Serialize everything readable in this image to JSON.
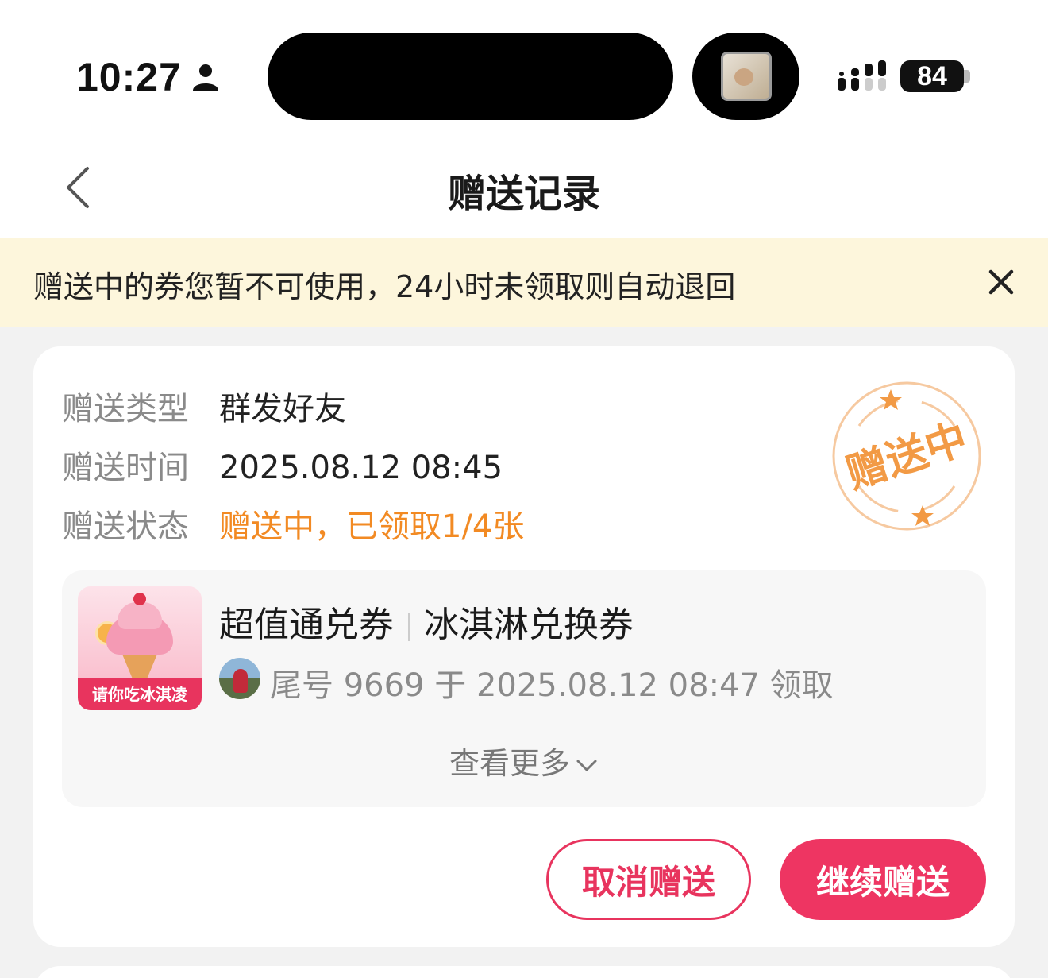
{
  "status_bar": {
    "time": "10:27",
    "battery": "84",
    "icons": [
      "person-icon",
      "signal-icon",
      "battery-icon"
    ]
  },
  "nav": {
    "title": "赠送记录",
    "back_icon": "chevron-left-icon"
  },
  "notice": {
    "text": "赠送中的券您暂不可使用，24小时未领取则自动退回",
    "close_icon": "close-icon"
  },
  "record": {
    "type_label": "赠送类型",
    "type_value": "群发好友",
    "time_label": "赠送时间",
    "time_value": "2025.08.12 08:45",
    "status_label": "赠送状态",
    "status_value": "赠送中，已领取1/4张",
    "stamp_text": "赠送中",
    "status_color": "#f28a23"
  },
  "coupon": {
    "image_label": "请你吃冰淇凌",
    "title_main": "超值通兑券",
    "title_sub": "冰淇淋兑换券",
    "claim_text": "尾号 9669  于 2025.08.12 08:47 领取",
    "more_label": "查看更多"
  },
  "actions": {
    "cancel_label": "取消赠送",
    "continue_label": "继续赠送",
    "accent_color": "#ee3562"
  }
}
